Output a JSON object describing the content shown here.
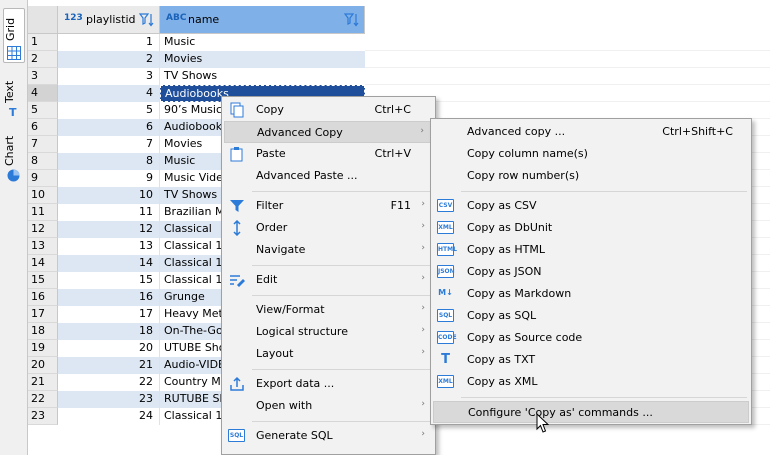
{
  "side_tabs": [
    {
      "label": "Grid",
      "active": true
    },
    {
      "label": "Text",
      "active": false
    },
    {
      "label": "Chart",
      "active": false
    }
  ],
  "columns": {
    "playlistid": {
      "type_icon": "123",
      "label": "playlistid"
    },
    "name": {
      "type_icon": "ABC",
      "label": "name"
    }
  },
  "rows": [
    {
      "n": "1",
      "id": "1",
      "name": "Music"
    },
    {
      "n": "2",
      "id": "2",
      "name": "Movies"
    },
    {
      "n": "3",
      "id": "3",
      "name": "TV Shows"
    },
    {
      "n": "4",
      "id": "4",
      "name": "Audiobooks"
    },
    {
      "n": "5",
      "id": "5",
      "name": "90’s Music"
    },
    {
      "n": "6",
      "id": "6",
      "name": "Audiobooks"
    },
    {
      "n": "7",
      "id": "7",
      "name": "Movies"
    },
    {
      "n": "8",
      "id": "8",
      "name": "Music"
    },
    {
      "n": "9",
      "id": "9",
      "name": "Music Videos"
    },
    {
      "n": "10",
      "id": "10",
      "name": "TV Shows"
    },
    {
      "n": "11",
      "id": "11",
      "name": "Brazilian Music"
    },
    {
      "n": "12",
      "id": "12",
      "name": "Classical"
    },
    {
      "n": "13",
      "id": "13",
      "name": "Classical 101"
    },
    {
      "n": "14",
      "id": "14",
      "name": "Classical 101"
    },
    {
      "n": "15",
      "id": "15",
      "name": "Classical 101"
    },
    {
      "n": "16",
      "id": "16",
      "name": "Grunge"
    },
    {
      "n": "17",
      "id": "17",
      "name": "Heavy Metal"
    },
    {
      "n": "18",
      "id": "18",
      "name": "On-The-Go"
    },
    {
      "n": "19",
      "id": "20",
      "name": "UTUBE Shows"
    },
    {
      "n": "20",
      "id": "21",
      "name": "Audio-VIDEO"
    },
    {
      "n": "21",
      "id": "22",
      "name": "Country Music"
    },
    {
      "n": "22",
      "id": "23",
      "name": "RUTUBE Shows"
    },
    {
      "n": "23",
      "id": "24",
      "name": "Classical 101"
    }
  ],
  "selected_row": 4,
  "context_menu": {
    "copy": {
      "label": "Copy",
      "shortcut": "Ctrl+C"
    },
    "advanced_copy": {
      "label": "Advanced Copy"
    },
    "paste": {
      "label": "Paste",
      "shortcut": "Ctrl+V"
    },
    "advanced_paste": {
      "label": "Advanced Paste ..."
    },
    "filter": {
      "label": "Filter",
      "shortcut": "F11"
    },
    "order": {
      "label": "Order"
    },
    "navigate": {
      "label": "Navigate"
    },
    "edit": {
      "label": "Edit"
    },
    "view_format": {
      "label": "View/Format"
    },
    "logical_structure": {
      "label": "Logical structure"
    },
    "layout": {
      "label": "Layout"
    },
    "export_data": {
      "label": "Export data ..."
    },
    "open_with": {
      "label": "Open with"
    },
    "generate_sql": {
      "label": "Generate SQL"
    }
  },
  "submenu": {
    "advanced_copy": {
      "label": "Advanced copy ...",
      "shortcut": "Ctrl+Shift+C"
    },
    "copy_column_names": {
      "label": "Copy column name(s)"
    },
    "copy_row_numbers": {
      "label": "Copy row number(s)"
    },
    "copy_csv": {
      "label": "Copy as CSV",
      "badge": "CSV"
    },
    "copy_dbunit": {
      "label": "Copy as DbUnit",
      "badge": "XML"
    },
    "copy_html": {
      "label": "Copy as HTML",
      "badge": "HTML"
    },
    "copy_json": {
      "label": "Copy as JSON",
      "badge": "JSON"
    },
    "copy_markdown": {
      "label": "Copy as Markdown",
      "badge": "M↓"
    },
    "copy_sql": {
      "label": "Copy as SQL",
      "badge": "SQL"
    },
    "copy_source": {
      "label": "Copy as Source code",
      "badge": "CODE"
    },
    "copy_txt": {
      "label": "Copy as TXT",
      "badge": "T"
    },
    "copy_xml": {
      "label": "Copy as XML",
      "badge": "XML"
    },
    "configure": {
      "label": "Configure 'Copy as' commands ..."
    }
  },
  "colors": {
    "selection": "#1f4f9b",
    "header_active": "#7fb0e8",
    "alt_row": "#dde7f3",
    "accent": "#2d7bd8"
  }
}
